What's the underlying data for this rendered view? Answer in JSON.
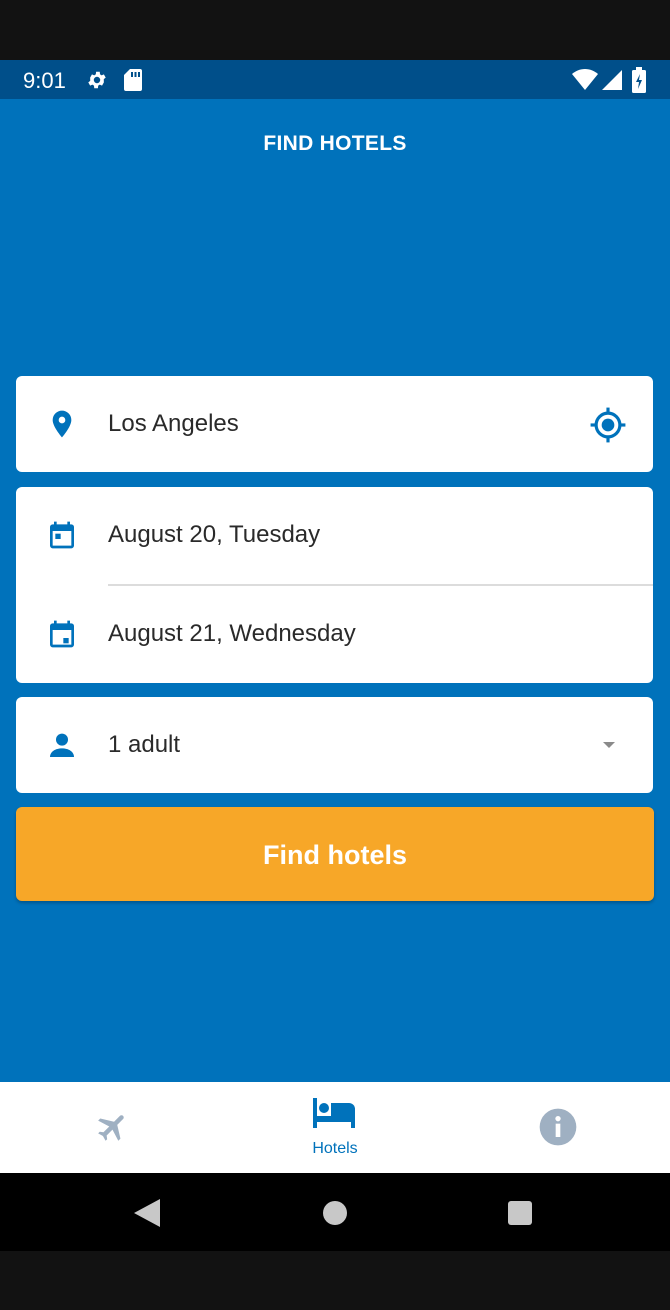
{
  "status_bar": {
    "time": "9:01",
    "icons": [
      "gear-icon",
      "sd-card-icon",
      "wifi-icon",
      "signal-icon",
      "battery-icon"
    ]
  },
  "header": {
    "title": "FIND HOTELS"
  },
  "search": {
    "location": {
      "value": "Los Angeles",
      "icon": "location-pin-icon",
      "action_icon": "my-location-icon"
    },
    "check_in": {
      "value": "August 20, Tuesday",
      "icon": "calendar-icon"
    },
    "check_out": {
      "value": "August 21, Wednesday",
      "icon": "calendar-icon"
    },
    "guests": {
      "value": "1 adult",
      "icon": "person-icon"
    },
    "submit_label": "Find hotels"
  },
  "bottom_nav": {
    "items": [
      {
        "icon": "airplane-icon",
        "label": "",
        "active": false
      },
      {
        "icon": "bed-icon",
        "label": "Hotels",
        "active": true
      },
      {
        "icon": "info-icon",
        "label": "",
        "active": false
      }
    ]
  },
  "colors": {
    "primary": "#0072bb",
    "status_bar": "#004f8a",
    "accent": "#f7a728",
    "nav_inactive": "#9fb0c2"
  }
}
